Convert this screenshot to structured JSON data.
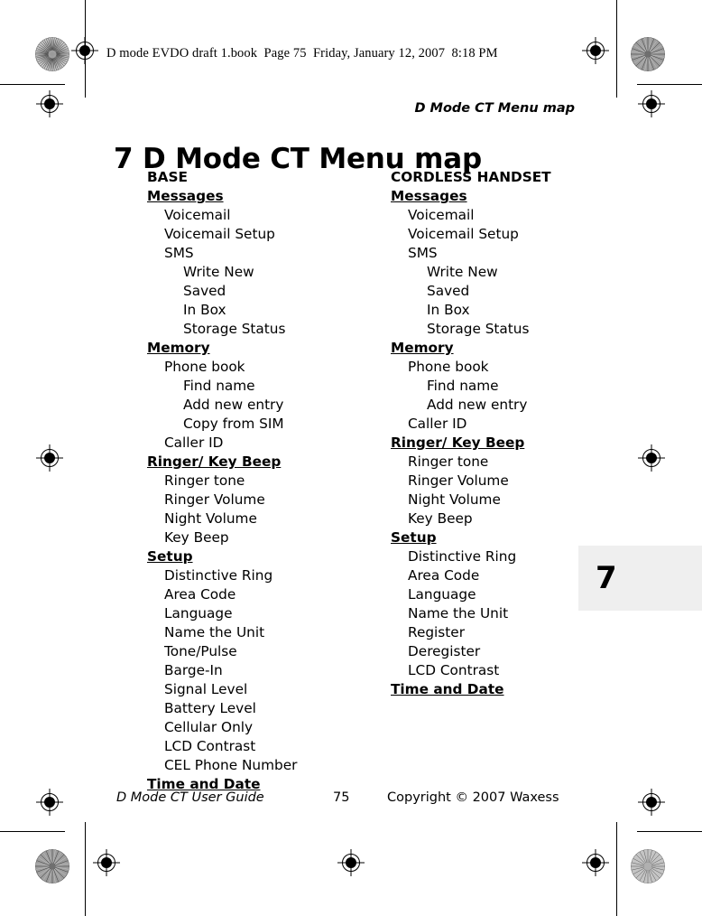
{
  "print_banner": {
    "text": "D mode EVDO draft 1.book  Page 75  Friday, January 12, 2007  8:18 PM"
  },
  "running_header": {
    "text": "D Mode CT Menu map"
  },
  "chapter": {
    "title": "7 D Mode CT Menu map",
    "number": "7"
  },
  "columns": [
    {
      "id": "base",
      "heading": "BASE",
      "rows": [
        {
          "level": "title",
          "label": "BASE"
        },
        {
          "level": "group",
          "label": "Messages"
        },
        {
          "level": "1",
          "label": "Voicemail"
        },
        {
          "level": "1",
          "label": "Voicemail Setup"
        },
        {
          "level": "1",
          "label": "SMS"
        },
        {
          "level": "2",
          "label": "Write New"
        },
        {
          "level": "2",
          "label": "Saved"
        },
        {
          "level": "2",
          "label": "In Box"
        },
        {
          "level": "2",
          "label": "Storage Status"
        },
        {
          "level": "group",
          "label": "Memory"
        },
        {
          "level": "1",
          "label": "Phone book"
        },
        {
          "level": "2",
          "label": "Find name"
        },
        {
          "level": "2",
          "label": "Add new entry"
        },
        {
          "level": "2",
          "label": "Copy from SIM"
        },
        {
          "level": "1",
          "label": "Caller ID"
        },
        {
          "level": "group",
          "label": "Ringer/ Key Beep"
        },
        {
          "level": "1",
          "label": "Ringer tone"
        },
        {
          "level": "1",
          "label": "Ringer Volume"
        },
        {
          "level": "1",
          "label": "Night Volume"
        },
        {
          "level": "1",
          "label": "Key Beep"
        },
        {
          "level": "group",
          "label": "Setup"
        },
        {
          "level": "1",
          "label": "Distinctive Ring"
        },
        {
          "level": "1",
          "label": "Area Code"
        },
        {
          "level": "1",
          "label": "Language"
        },
        {
          "level": "1",
          "label": "Name the Unit"
        },
        {
          "level": "1",
          "label": "Tone/Pulse"
        },
        {
          "level": "1",
          "label": "Barge-In"
        },
        {
          "level": "1",
          "label": "Signal Level"
        },
        {
          "level": "1",
          "label": "Battery Level"
        },
        {
          "level": "1",
          "label": "Cellular Only"
        },
        {
          "level": "1",
          "label": "LCD Contrast"
        },
        {
          "level": "1",
          "label": "CEL Phone Number"
        },
        {
          "level": "group",
          "label": "Time and Date"
        }
      ]
    },
    {
      "id": "handset",
      "heading": "CORDLESS HANDSET",
      "rows": [
        {
          "level": "title",
          "label": "CORDLESS HANDSET"
        },
        {
          "level": "group",
          "label": "Messages"
        },
        {
          "level": "1",
          "label": "Voicemail"
        },
        {
          "level": "1",
          "label": "Voicemail Setup"
        },
        {
          "level": "1",
          "label": "SMS"
        },
        {
          "level": "2",
          "label": "Write New"
        },
        {
          "level": "2",
          "label": "Saved"
        },
        {
          "level": "2",
          "label": "In Box"
        },
        {
          "level": "2",
          "label": "Storage Status"
        },
        {
          "level": "group",
          "label": "Memory"
        },
        {
          "level": "1",
          "label": "Phone book"
        },
        {
          "level": "2",
          "label": "Find name"
        },
        {
          "level": "2",
          "label": "Add new entry"
        },
        {
          "level": "1",
          "label": "Caller ID"
        },
        {
          "level": "group",
          "label": "Ringer/ Key Beep"
        },
        {
          "level": "1",
          "label": "Ringer tone"
        },
        {
          "level": "1",
          "label": "Ringer Volume"
        },
        {
          "level": "1",
          "label": "Night Volume"
        },
        {
          "level": "1",
          "label": "Key Beep"
        },
        {
          "level": "group",
          "label": "Setup"
        },
        {
          "level": "1",
          "label": "Distinctive Ring"
        },
        {
          "level": "1",
          "label": "Area Code"
        },
        {
          "level": "1",
          "label": "Language"
        },
        {
          "level": "1",
          "label": "Name the Unit"
        },
        {
          "level": "1",
          "label": "Register"
        },
        {
          "level": "1",
          "label": "Deregister"
        },
        {
          "level": "1",
          "label": "LCD Contrast"
        },
        {
          "level": "group",
          "label": "Time and Date"
        }
      ]
    }
  ],
  "footer": {
    "guide": "D Mode CT User Guide",
    "page": "75",
    "copyright": "Copyright © 2007 Waxess"
  },
  "colors": {
    "tab_background": "#efefef",
    "text": "#000000",
    "page": "#ffffff"
  },
  "print_marks": {
    "registration_icon": "registration-target-icon",
    "rosette_icon": "print-rosette-icon",
    "trim_line_icon": "trim-line"
  }
}
